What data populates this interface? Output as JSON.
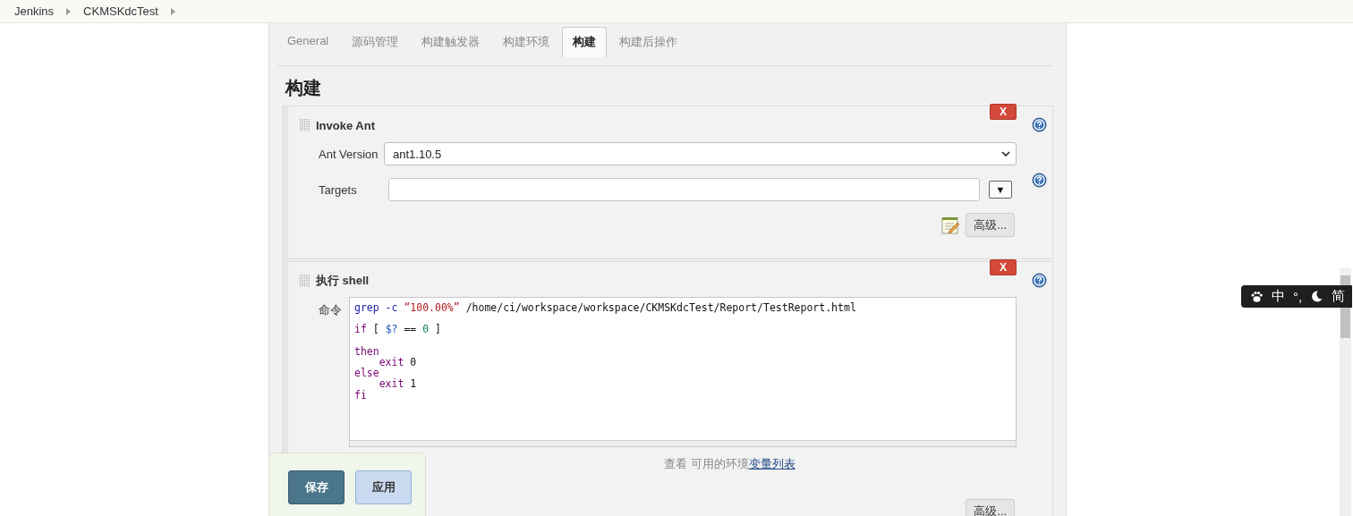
{
  "breadcrumb": [
    {
      "label": "Jenkins"
    },
    {
      "label": "CKMSKdcTest"
    }
  ],
  "tabs": [
    {
      "label": "General",
      "selected": false
    },
    {
      "label": "源码管理",
      "selected": false
    },
    {
      "label": "构建触发器",
      "selected": false
    },
    {
      "label": "构建环境",
      "selected": false
    },
    {
      "label": "构建",
      "selected": true
    },
    {
      "label": "构建后操作",
      "selected": false
    }
  ],
  "section_title": "构建",
  "steps": [
    {
      "kind": "ant",
      "title": "Invoke Ant",
      "delete_label": "X",
      "fields": [
        {
          "kind": "select",
          "label": "Ant Version",
          "value": "ant1.10.5"
        },
        {
          "kind": "text",
          "label": "Targets",
          "dropdown_button": "▼"
        }
      ],
      "advanced_button": "高级..."
    },
    {
      "kind": "shell",
      "title": "执行 shell",
      "delete_label": "X",
      "command_label": "命令",
      "code_lines": [
        {
          "blank_after": true,
          "tokens": [
            {
              "kind": "builtin",
              "text": "grep -c "
            },
            {
              "kind": "string",
              "text": "“100.00%”"
            },
            {
              "kind": "plain",
              "text": " /home/ci/workspace/workspace/CKMSKdcTest/Report/TestReport.html"
            }
          ]
        },
        {
          "blank_after": true,
          "tokens": [
            {
              "kind": "keyword",
              "text": "if"
            },
            {
              "kind": "plain",
              "text": " [ "
            },
            {
              "kind": "variable",
              "text": "$?"
            },
            {
              "kind": "plain",
              "text": " == "
            },
            {
              "kind": "number",
              "text": "0"
            },
            {
              "kind": "plain",
              "text": " ]"
            }
          ]
        },
        {
          "tokens": [
            {
              "kind": "keyword",
              "text": "then"
            }
          ]
        },
        {
          "indented": true,
          "tokens": [
            {
              "kind": "keyword",
              "text": "exit"
            },
            {
              "kind": "plain",
              "text": " 0"
            }
          ]
        },
        {
          "tokens": [
            {
              "kind": "keyword",
              "text": "else"
            }
          ]
        },
        {
          "indented": true,
          "tokens": [
            {
              "kind": "keyword",
              "text": "exit"
            },
            {
              "kind": "plain",
              "text": " 1"
            }
          ]
        },
        {
          "tokens": [
            {
              "kind": "keyword",
              "text": "fi"
            }
          ]
        }
      ],
      "help_text": "查看 可用的环境",
      "help_link": "变量列表",
      "advanced_button": "高级..."
    }
  ],
  "save_bar": [
    {
      "kind": "primary",
      "label": "保存"
    },
    {
      "kind": "secondary",
      "label": "应用"
    }
  ],
  "ime_toolbar": [
    {
      "kind": "icon"
    },
    {
      "kind": "text",
      "label": "中"
    },
    {
      "kind": "text",
      "label": "°,"
    },
    {
      "kind": "moon"
    },
    {
      "kind": "text",
      "label": "简"
    }
  ]
}
